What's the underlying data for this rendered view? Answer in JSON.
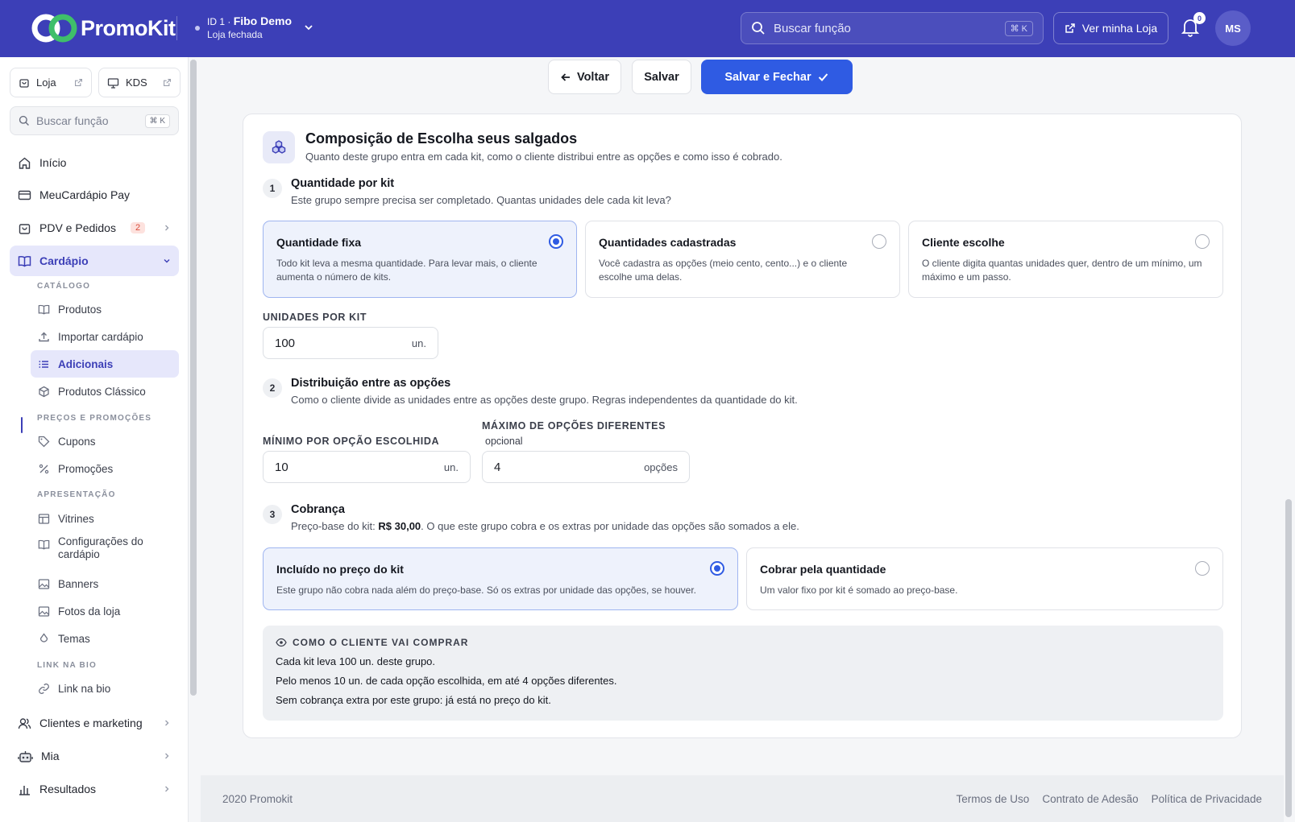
{
  "brand": {
    "name": "PromoKit",
    "primary": "#3c3fb7",
    "accent": "#2f5be3"
  },
  "store": {
    "id_prefix": "ID 1 ·",
    "name": "Fibo Demo",
    "status": "Loja fechada"
  },
  "topbar": {
    "search_placeholder": "Buscar função",
    "search_shortcut": "⌘ K",
    "view_store": "Ver minha Loja",
    "notifications_count": "0",
    "avatar_initials": "MS"
  },
  "sidebar": {
    "quick": [
      {
        "label": "Loja"
      },
      {
        "label": "KDS"
      }
    ],
    "search_placeholder": "Buscar função",
    "search_shortcut": "⌘ K",
    "items": {
      "inicio": "Início",
      "meucardapio": "MeuCardápio Pay",
      "pdv": "PDV e Pedidos",
      "pdv_badge": "2",
      "cardapio": "Cardápio",
      "clientes": "Clientes e marketing",
      "mia": "Mia",
      "resultados": "Resultados"
    },
    "sections": {
      "catalogo": "CATÁLOGO",
      "precos": "PREÇOS E PROMOÇÕES",
      "apresentacao": "APRESENTAÇÃO",
      "link": "LINK NA BIO"
    },
    "sub": {
      "produtos": "Produtos",
      "importar": "Importar cardápio",
      "adicionais": "Adicionais",
      "classico": "Produtos Clássico",
      "cupons": "Cupons",
      "promocoes": "Promoções",
      "vitrines": "Vitrines",
      "config": "Configurações do cardápio",
      "banners": "Banners",
      "fotos": "Fotos da loja",
      "temas": "Temas",
      "linkbio": "Link na bio"
    }
  },
  "actions": {
    "back": "Voltar",
    "save": "Salvar",
    "save_close": "Salvar e Fechar"
  },
  "card": {
    "title": "Composição de Escolha seus salgados",
    "subtitle": "Quanto deste grupo entra em cada kit, como o cliente distribui entre as opções e como isso é cobrado.",
    "step1": {
      "num": "1",
      "title": "Quantidade por kit",
      "subtitle": "Este grupo sempre precisa ser completado. Quantas unidades dele cada kit leva?",
      "options": [
        {
          "title": "Quantidade fixa",
          "desc": "Todo kit leva a mesma quantidade. Para levar mais, o cliente aumenta o número de kits.",
          "selected": true
        },
        {
          "title": "Quantidades cadastradas",
          "desc": "Você cadastra as opções (meio cento, cento...) e o cliente escolhe uma delas.",
          "selected": false
        },
        {
          "title": "Cliente escolhe",
          "desc": "O cliente digita quantas unidades quer, dentro de um mínimo, um máximo e um passo.",
          "selected": false
        }
      ],
      "units_label": "UNIDADES POR KIT",
      "units_value": "100",
      "units_suffix": "un."
    },
    "step2": {
      "num": "2",
      "title": "Distribuição entre as opções",
      "subtitle": "Como o cliente divide as unidades entre as opções deste grupo. Regras independentes da quantidade do kit.",
      "min_label": "MÍNIMO POR OPÇÃO ESCOLHIDA",
      "min_value": "10",
      "min_suffix": "un.",
      "max_label": "MÁXIMO DE OPÇÕES DIFERENTES",
      "max_optional": "opcional",
      "max_value": "4",
      "max_suffix": "opções"
    },
    "step3": {
      "num": "3",
      "title": "Cobrança",
      "subtitle_pre": "Preço-base do kit: ",
      "subtitle_price": "R$ 30,00",
      "subtitle_post": ". O que este grupo cobra e os extras por unidade das opções são somados a ele.",
      "options": [
        {
          "title": "Incluído no preço do kit",
          "desc": "Este grupo não cobra nada além do preço-base. Só os extras por unidade das opções, se houver.",
          "selected": true
        },
        {
          "title": "Cobrar pela quantidade",
          "desc": "Um valor fixo por kit é somado ao preço-base.",
          "selected": false
        }
      ]
    },
    "preview": {
      "title": "COMO O CLIENTE VAI COMPRAR",
      "lines": [
        "Cada kit leva 100 un. deste grupo.",
        "Pelo menos 10 un. de cada opção escolhida, em até 4 opções diferentes.",
        "Sem cobrança extra por este grupo: já está no preço do kit."
      ]
    }
  },
  "footer": {
    "copyright": "2020 Promokit",
    "links": [
      "Termos de Uso",
      "Contrato de Adesão",
      "Política de Privacidade"
    ]
  }
}
